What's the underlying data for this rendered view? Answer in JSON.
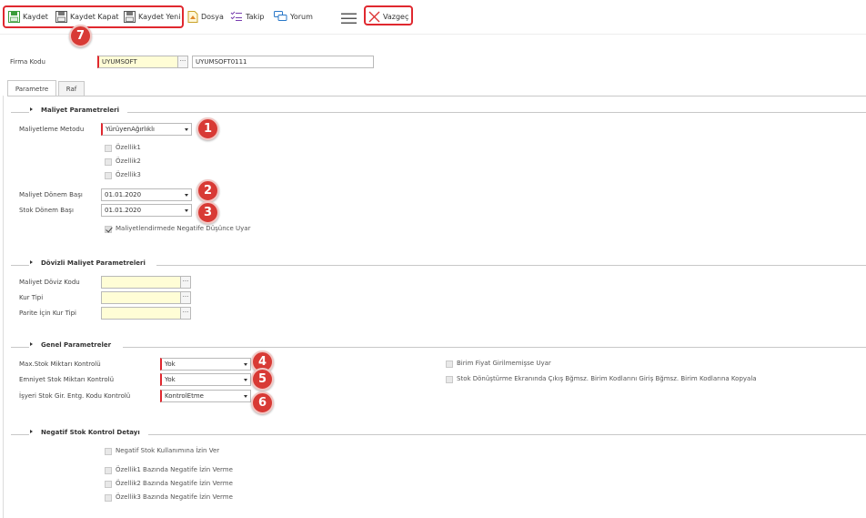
{
  "toolbar": {
    "kaydet": "Kaydet",
    "kaydet_kapat": "Kaydet Kapat",
    "kaydet_yeni": "Kaydet Yeni",
    "dosya": "Dosya",
    "takip": "Takip",
    "yorum": "Yorum",
    "vazgec": "Vazgeç"
  },
  "header": {
    "firma_label": "Firma Kodu",
    "firma_code": "UYUMSOFT",
    "firma_desc": "UYUMSOFT0111"
  },
  "tabs": [
    "Parametre",
    "Raf"
  ],
  "badges": [
    "1",
    "2",
    "3",
    "4",
    "5",
    "6",
    "7"
  ],
  "maliyet": {
    "title": "Maliyet Parametreleri",
    "metod_label": "Maliyetleme Metodu",
    "metod_value": "YürüyenAğırlıklı",
    "ozellik1": "Özellik1",
    "ozellik2": "Özellik2",
    "ozellik3": "Özellik3",
    "donem_label": "Maliyet Dönem Başı",
    "donem_value": "01.01.2020",
    "stok_donem_label": "Stok Dönem Başı",
    "stok_donem_value": "01.01.2020",
    "negatif_uyar": "Maliyetlendirmede Negatife Düşünce Uyar"
  },
  "dovizli": {
    "title": "Dövizli Maliyet Parametreleri",
    "doviz_kodu": "Maliyet Döviz Kodu",
    "kur_tipi": "Kur Tipi",
    "parite": "Parite İçin Kur Tipi"
  },
  "genel": {
    "title": "Genel Parametreler",
    "max_label": "Max.Stok Miktarı Kontrolü",
    "max_value": "Yok",
    "emniyet_label": "Emniyet Stok Miktarı Kontrolü",
    "emniyet_value": "Yok",
    "isyeri_label": "İşyeri Stok Gir. Entg. Kodu Kontrolü",
    "isyeri_value": "KontrolEtme",
    "birim_fiyat": "Birim Fiyat Girilmemişse Uyar",
    "stok_donusturme": "Stok Dönüştürme Ekranında Çıkış Bğmsz. Birim Kodlarını Giriş Bğmsz. Birim Kodlarına Kopyala"
  },
  "negatif": {
    "title": "Negatif Stok Kontrol Detayı",
    "izin_ver": "Negatif Stok Kullanımına İzin Ver",
    "oz1": "Özellik1 Bazında Negatife İzin Verme",
    "oz2": "Özellik2 Bazında Negatife İzin Verme",
    "oz3": "Özellik3 Bazında Negatife İzin Verme"
  }
}
